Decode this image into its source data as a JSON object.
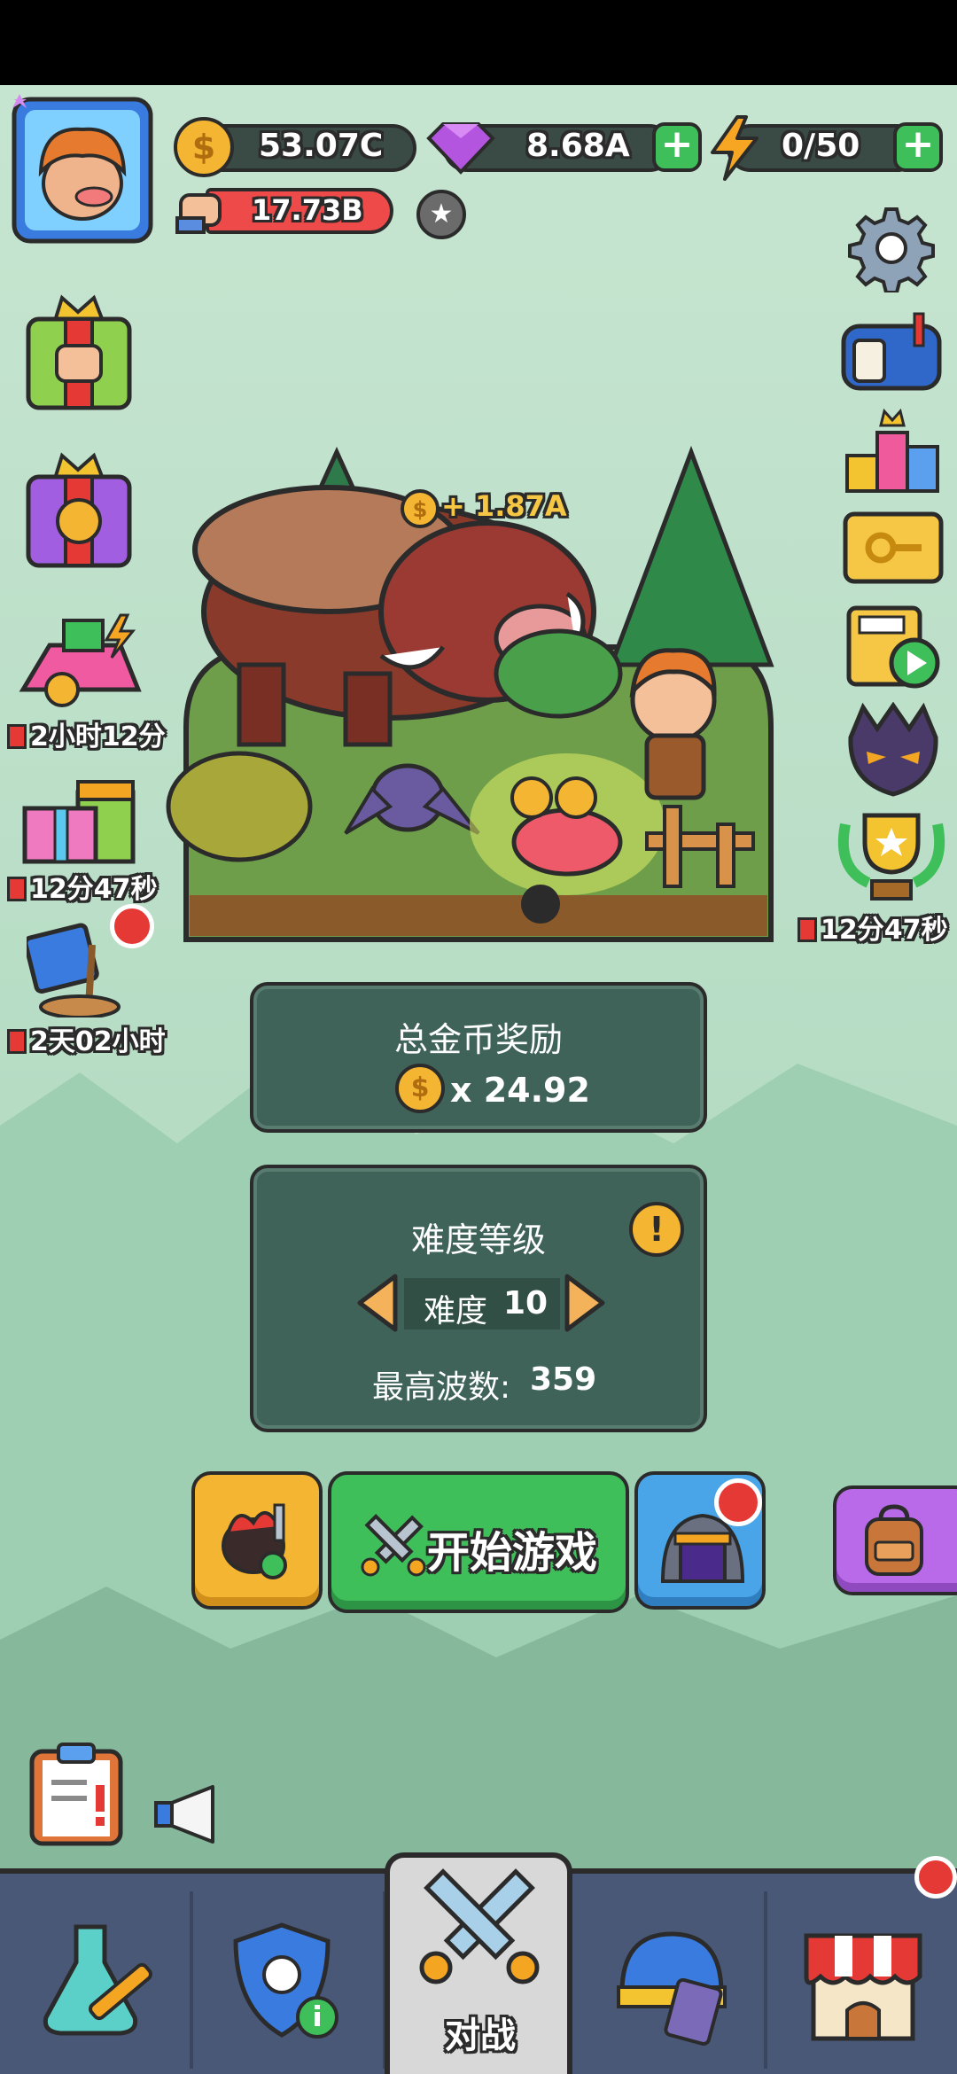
{
  "resources": {
    "coins": "53.07C",
    "gems": "8.68A",
    "energy": "0/50",
    "power": "17.73B",
    "plus_symbol": "+"
  },
  "timers": {
    "pink_shop": "2小时12分",
    "gift_box": "12分47秒",
    "map_event": "2天02小时",
    "trophy": "12分47秒"
  },
  "scene": {
    "coin_gain": "+ 1.87A"
  },
  "reward_panel": {
    "title": "总金币奖励",
    "multiplier": "x 24.92"
  },
  "difficulty_panel": {
    "title": "难度等级",
    "level_label": "难度",
    "level_value": "10",
    "max_wave_label": "最高波数:",
    "max_wave_value": "359",
    "info_symbol": "!"
  },
  "actions": {
    "start_game": "开始游戏"
  },
  "nav": {
    "battle_label": "对战"
  },
  "colors": {
    "start_green": "#3fbf5a",
    "gem_purple": "#b455e0",
    "coin_gold": "#f4b532",
    "power_red": "#ef4a4a",
    "nav_blue": "#4a5878"
  },
  "icons": [
    "settings-icon",
    "mailbox-icon",
    "leaderboard-icon",
    "key-ticket-icon",
    "video-reward-icon",
    "demon-mask-icon",
    "trophy-icon",
    "fist-chest-icon",
    "coin-chest-icon",
    "pink-machine-icon",
    "gift-box-icon",
    "map-sign-icon",
    "clipboard-icon",
    "megaphone-icon",
    "potion-wrench-icon",
    "shield-profile-icon",
    "crossed-swords-icon",
    "helmet-cards-icon",
    "shop-icon",
    "backpack-icon",
    "portal-icon",
    "berserk-icon",
    "swords-icon"
  ]
}
